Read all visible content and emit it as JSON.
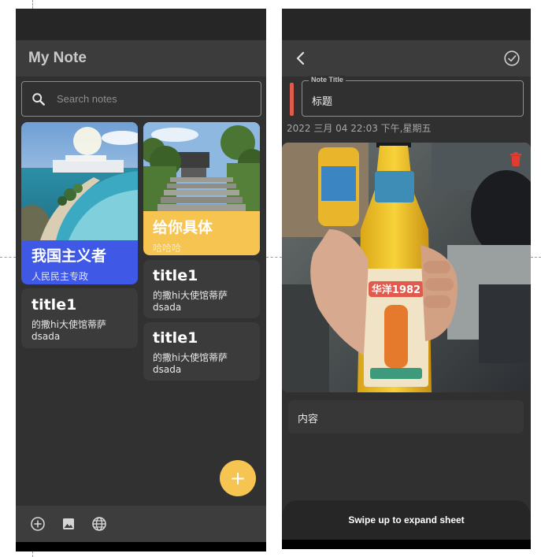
{
  "left_screen": {
    "app_title": "My Note",
    "search": {
      "placeholder": "Search notes",
      "icon": "search-icon"
    },
    "cards": [
      {
        "title": "我国主义者",
        "subtitle": "人民民主专政",
        "color": "#3f59e6",
        "image": "ocean-resort-photo"
      },
      {
        "title": "title1",
        "subtitle": "的撒hi大使馆蒂萨",
        "extra": "dsada",
        "color": "#3b3b3b"
      },
      {
        "title": "给你具体",
        "subtitle": "哈哈哈",
        "color": "#f5c451",
        "image": "garden-stairs-photo"
      },
      {
        "title": "title1",
        "subtitle": "的撒hi大使馆蒂萨",
        "extra": "dsada",
        "color": "#3b3b3b"
      },
      {
        "title": "title1",
        "subtitle": "的撒hi大使馆蒂萨",
        "extra": "dsada",
        "color": "#3b3b3b"
      }
    ],
    "fab": {
      "label": "+",
      "color": "#f5c451"
    },
    "bottom_bar": {
      "icons": [
        "add-circle-icon",
        "image-icon",
        "globe-icon"
      ]
    }
  },
  "right_screen": {
    "back_icon": "chevron-left-icon",
    "save_icon": "check-circle-icon",
    "note_title_label": "Note Title",
    "note_title_value": "标题",
    "date_text": "2022 三月 04 22:03 下午,星期五",
    "photo": "bottle-photo",
    "photo_label_text": "华洋1982",
    "delete_icon": "trash-icon",
    "content_text": "内容",
    "sheet_text": "Swipe up to expand sheet",
    "accent_color": "#e05a4e"
  }
}
